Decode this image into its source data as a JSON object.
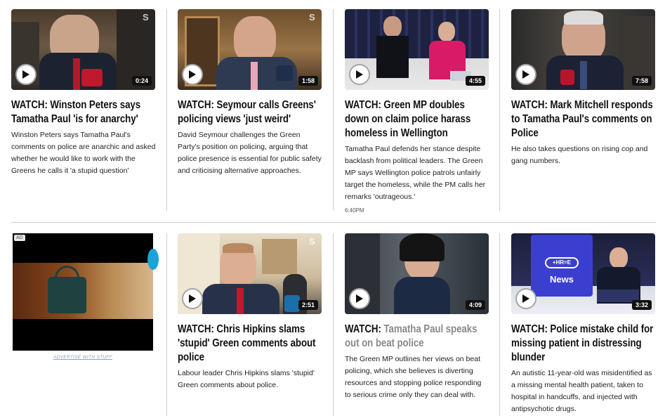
{
  "row1": [
    {
      "duration": "0:24",
      "headline_prefix": "WATCH: ",
      "headline_main": "Winston Peters says Tamatha Paul 'is for anarchy'",
      "headline_grey": "",
      "summary": "Winston Peters says Tamatha Paul's comments on police are anarchic and asked whether he would like to work with the Greens he calls it 'a stupid question'",
      "time": ""
    },
    {
      "duration": "1:58",
      "headline_prefix": "WATCH: ",
      "headline_main": "Seymour calls Greens' policing views 'just weird'",
      "headline_grey": "",
      "summary": "David Seymour challenges the Green Party's position on policing, arguing that police presence is essential for public safety and criticising alternative approaches.",
      "time": ""
    },
    {
      "duration": "4:55",
      "headline_prefix": "WATCH: ",
      "headline_main": "Green MP doubles down on claim police harass homeless in Wellington",
      "headline_grey": "",
      "summary": "Tamatha Paul defends her stance despite backlash from political leaders. The Green MP says Wellington police patrols unfairly target the homeless, while the PM calls her remarks 'outrageous.'",
      "time": "6:40PM"
    },
    {
      "duration": "7:58",
      "headline_prefix": "WATCH: ",
      "headline_main": "Mark Mitchell responds to Tamatha Paul's comments on Police",
      "headline_grey": "",
      "summary": "He also takes questions on rising cop and gang numbers.",
      "time": ""
    }
  ],
  "ad": {
    "label": "AD",
    "link": "ADVERTISE WITH STUFF"
  },
  "row2": [
    {
      "duration": "2:51",
      "headline_prefix": "WATCH: ",
      "headline_main": "Chris Hipkins slams 'stupid' Green comments about police",
      "headline_grey": "",
      "summary": "Labour leader Chris Hipkins slams 'stupid' Green comments about police.",
      "time": ""
    },
    {
      "duration": "4:09",
      "headline_prefix": "WATCH: ",
      "headline_main": "",
      "headline_grey": "Tamatha Paul speaks out on beat police",
      "summary": "The Green MP outlines her views on beat policing, which she believes is diverting resources and stopping police responding to serious crime only they can deal with.",
      "time": ""
    },
    {
      "duration": "3:32",
      "headline_prefix": "WATCH: ",
      "headline_main": "Police mistake child for missing patient in distressing blunder",
      "headline_grey": "",
      "summary": "An autistic 11-year-old was misidentified as a missing mental health patient, taken to hospital in handcuffs, and injected with antipsychotic drugs.",
      "time": ""
    }
  ],
  "tv_logo": "News",
  "colors": {
    "divider": "#cfcfcf",
    "text": "#111111",
    "grey_text": "#8a8a8a"
  }
}
